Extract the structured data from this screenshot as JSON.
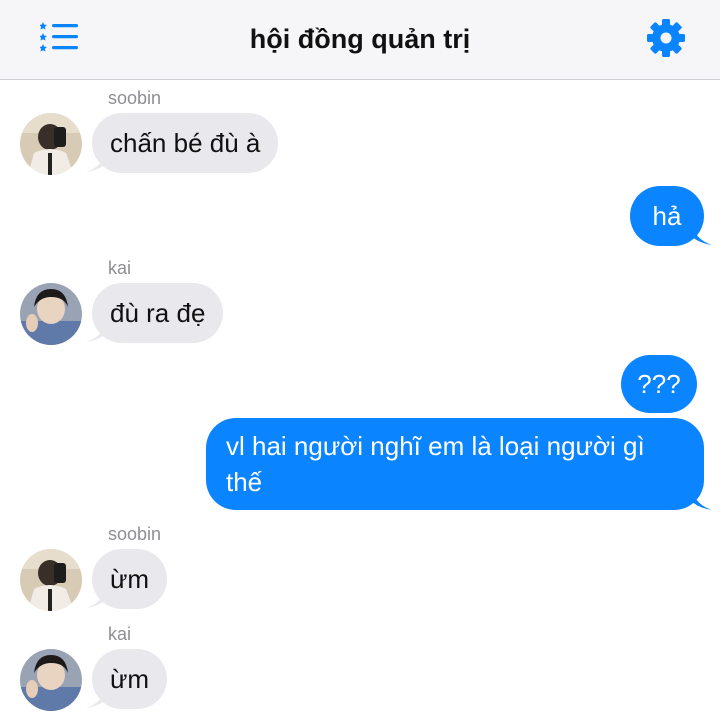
{
  "header": {
    "title": "hội đồng quản trị",
    "menu_icon": "list-icon",
    "settings_icon": "gear-icon",
    "accent_color": "#0b84ff"
  },
  "messages": [
    {
      "sender": "soobin",
      "text": "chấn bé đù à",
      "direction": "incoming"
    },
    {
      "text": "hả",
      "direction": "outgoing"
    },
    {
      "sender": "kai",
      "text": "đù ra đẹ",
      "direction": "incoming"
    },
    {
      "text": "???",
      "direction": "outgoing"
    },
    {
      "text": "vl hai người nghĩ em là loại người gì thế",
      "direction": "outgoing"
    },
    {
      "sender": "soobin",
      "text": "ừm",
      "direction": "incoming"
    },
    {
      "sender": "kai",
      "text": "ừm",
      "direction": "incoming"
    }
  ],
  "colors": {
    "incoming_bubble": "#e8e8ed",
    "outgoing_bubble": "#0b84ff",
    "header_bg": "#f6f6f8"
  }
}
